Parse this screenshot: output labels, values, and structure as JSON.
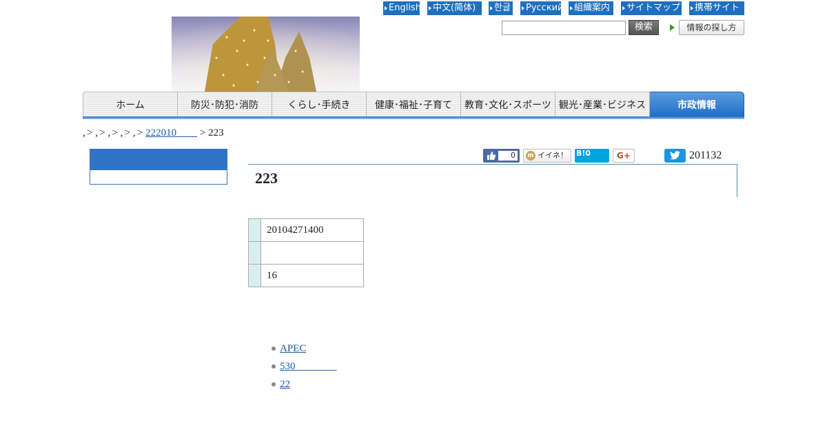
{
  "top_links": [
    {
      "label": "English"
    },
    {
      "label": "中文(简体)"
    },
    {
      "label": "한글"
    },
    {
      "label": "Русский"
    },
    {
      "label": "組織案内"
    },
    {
      "label": "サイトマップ"
    },
    {
      "label": "携帯サイト"
    }
  ],
  "search": {
    "button_label": "検索",
    "value": "",
    "howto_label": "情報の探し方"
  },
  "nav": {
    "items": [
      {
        "label": "ホーム"
      },
      {
        "label": "防災･防犯･消防"
      },
      {
        "label": "くらし･手続き"
      },
      {
        "label": "健康･福祉･子育て"
      },
      {
        "label": "教育･文化･スポーツ"
      },
      {
        "label": "観光･産業･ビジネス"
      },
      {
        "label": "市政情報"
      }
    ],
    "active": "市政情報"
  },
  "breadcrumb": {
    "link_text": "222010　　",
    "current": "223",
    "separator": ">"
  },
  "social": {
    "fb_count": "0",
    "mixi_label": "イイネ！",
    "hatena_label": "B!0",
    "gplus_label": "G+"
  },
  "page": {
    "id_text": "201132",
    "title": "223"
  },
  "info_rows": [
    {
      "value": "20104271400"
    },
    {
      "value": ""
    },
    {
      "value": "16"
    }
  ],
  "links": [
    {
      "label": "APEC"
    },
    {
      "label": "530　　　　"
    },
    {
      "label": "22"
    }
  ],
  "colors": {
    "accent_blue": "#1f6fbf",
    "nav_active": "#2f74c4",
    "link": "#1a5aa8"
  }
}
